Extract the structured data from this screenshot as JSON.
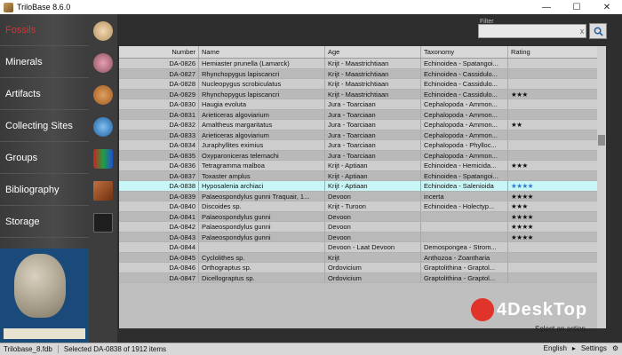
{
  "window": {
    "title": "TriloBase 8.6.0",
    "min": "—",
    "max": "☐",
    "close": "✕"
  },
  "nav": [
    {
      "label": "Fossils",
      "active": true
    },
    {
      "label": "Minerals"
    },
    {
      "label": "Artifacts"
    },
    {
      "label": "Collecting Sites"
    },
    {
      "label": "Groups"
    },
    {
      "label": "Bibliography"
    },
    {
      "label": "Storage"
    }
  ],
  "filter": {
    "label": "Filter",
    "value": "",
    "clear": "x"
  },
  "columns": [
    "Number",
    "Name",
    "Age",
    "Taxonomy",
    "Rating"
  ],
  "rows": [
    [
      "DA-0826",
      "Hemiaster prunella (Lamarck)",
      "Krijt - Maastrichtiaan",
      "Echinoidea - Spatangoi...",
      ""
    ],
    [
      "DA-0827",
      "Rhynchopygus lapiscancri",
      "Krijt - Maastrichtiaan",
      "Echinoidea - Cassidulo...",
      ""
    ],
    [
      "DA-0828",
      "Nucleopygus scrobiculatus",
      "Krijt - Maastrichtiaan",
      "Echinoidea - Cassidulo...",
      ""
    ],
    [
      "DA-0829",
      "Rhynchopygus lapiscancri",
      "Krijt - Maastrichtiaan",
      "Echinoidea - Cassidulo...",
      "★★★"
    ],
    [
      "DA-0830",
      "Haugia evoluta",
      "Jura - Toarciaan",
      "Cephalopoda - Ammon...",
      ""
    ],
    [
      "DA-0831",
      "Arieticeras algoviarium",
      "Jura - Toarciaan",
      "Cephalopoda - Ammon...",
      ""
    ],
    [
      "DA-0832",
      "Amaltheus margaritatus",
      "Jura - Toarciaan",
      "Cephalopoda - Ammon...",
      "★★"
    ],
    [
      "DA-0833",
      "Arieticeras algoviarium",
      "Jura - Toarciaan",
      "Cephalopoda - Ammon...",
      ""
    ],
    [
      "DA-0834",
      "Juraphyllites eximius",
      "Jura - Toarciaan",
      "Cephalopoda - Phylloc...",
      ""
    ],
    [
      "DA-0835",
      "Oxyparoniceras telemachi",
      "Jura - Toarciaan",
      "Cephalopoda - Ammon...",
      ""
    ],
    [
      "DA-0836",
      "Tetragramma malboa",
      "Krijt - Aptiaan",
      "Echinoidea - Hemicida...",
      "★★★"
    ],
    [
      "DA-0837",
      "Toxaster amplus",
      "Krijt - Aptiaan",
      "Echinoidea - Spatangoi...",
      ""
    ],
    [
      "DA-0838",
      "Hyposalenia archiaci",
      "Krijt - Aptiaan",
      "Echinoidea - Salenioida",
      "★★★★"
    ],
    [
      "DA-0839",
      "Palaeospondylus gunni Traquair, 1...",
      "Devoon",
      "incerta",
      "★★★★"
    ],
    [
      "DA-0840",
      "Discoides sp.",
      "Krijt - Turoon",
      "Echinoidea - Holectyp...",
      "★★★"
    ],
    [
      "DA-0841",
      "Palaeospondylus gunni",
      "Devoon",
      "",
      "★★★★"
    ],
    [
      "DA-0842",
      "Palaeospondylus gunni",
      "Devoon",
      "",
      "★★★★"
    ],
    [
      "DA-0843",
      "Palaeospondylus gunni",
      "Devoon",
      "",
      "★★★★"
    ],
    [
      "DA-0844",
      "",
      "Devoon - Laat Devoon",
      "Demospongea - Strom...",
      ""
    ],
    [
      "DA-0845",
      "Cyclolithes sp.",
      "Krijt",
      "Anthozoa - Zoantharia",
      ""
    ],
    [
      "DA-0846",
      "Orthograptus sp.",
      "Ordovicium",
      "Graptolithina - Graptol...",
      ""
    ],
    [
      "DA-0847",
      "Dicellograptus sp.",
      "Ordovicium",
      "Graptolithina - Graptol...",
      ""
    ]
  ],
  "selected_index": 12,
  "action_label": "Select an action...",
  "status": {
    "db": "Trilobase_8.fdb",
    "selection": "Selected DA-0838 of 1912 items",
    "language": "English",
    "settings": "Settings"
  },
  "watermark": "4DeskTop",
  "colors": {
    "accent_active": "#e03030",
    "selected_row": "#c8f6f6",
    "star": "#f0b020",
    "star_selected": "#2a7ad0"
  }
}
